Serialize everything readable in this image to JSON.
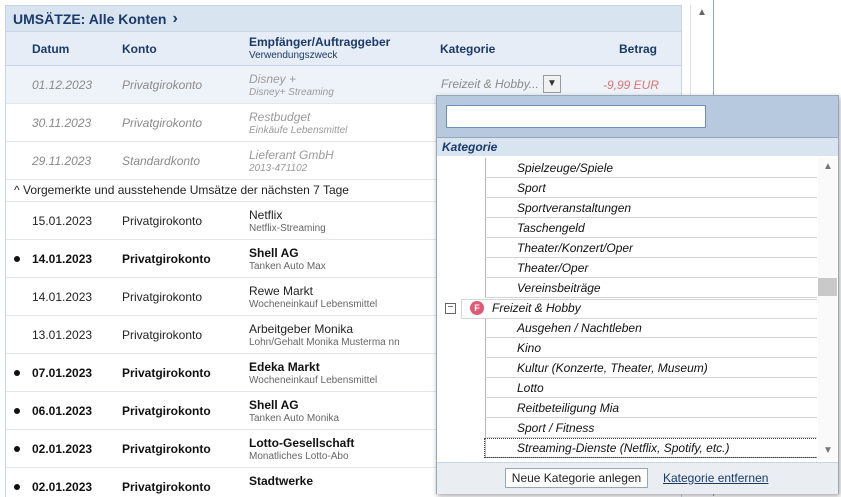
{
  "header": {
    "title": "UMSÄTZE: Alle Konten"
  },
  "columns": {
    "datum": "Datum",
    "konto": "Konto",
    "empfaenger": "Empfänger/Auftraggeber",
    "verwendung": "Verwendungszweck",
    "kategorie": "Kategorie",
    "betrag": "Betrag"
  },
  "past_rows": [
    {
      "date": "01.12.2023",
      "account": "Privatgirokonto",
      "payee": "Disney +",
      "purpose": "Disney+ Streaming",
      "category": "Freizeit & Hobby...",
      "amount": "-9,99 EUR"
    },
    {
      "date": "30.11.2023",
      "account": "Privatgirokonto",
      "payee": "Restbudget",
      "purpose": "Einkäufe Lebensmittel"
    },
    {
      "date": "29.11.2023",
      "account": "Standardkonto",
      "payee": "Lieferant GmbH",
      "purpose": "2013-471102"
    }
  ],
  "section": {
    "label": "Vorgemerkte und ausstehende Umsätze der nächsten 7 Tage"
  },
  "future_rows": [
    {
      "date": "15.01.2023",
      "account": "Privatgirokonto",
      "payee": "Netflix",
      "purpose": "Netflix-Streaming",
      "bold": false
    },
    {
      "date": "14.01.2023",
      "account": "Privatgirokonto",
      "payee": "Shell AG",
      "purpose": "Tanken Auto Max",
      "bold": true
    },
    {
      "date": "14.01.2023",
      "account": "Privatgirokonto",
      "payee": "Rewe Markt",
      "purpose": "Wocheneinkauf Lebensmittel",
      "bold": false
    },
    {
      "date": "13.01.2023",
      "account": "Privatgirokonto",
      "payee": "Arbeitgeber Monika",
      "purpose": "Lohn/Gehalt Monika Musterma nn",
      "bold": false
    },
    {
      "date": "07.01.2023",
      "account": "Privatgirokonto",
      "payee": "Edeka Markt",
      "purpose": "Wocheneinkauf Lebensmittel",
      "bold": true
    },
    {
      "date": "06.01.2023",
      "account": "Privatgirokonto",
      "payee": "Shell AG",
      "purpose": "Tanken Auto Monika",
      "bold": true
    },
    {
      "date": "02.01.2023",
      "account": "Privatgirokonto",
      "payee": "Lotto-Gesellschaft",
      "purpose": "Monatliches Lotto-Abo",
      "bold": true
    },
    {
      "date": "02.01.2023",
      "account": "Privatgirokonto",
      "payee": "Stadtwerke",
      "purpose": "",
      "bold": true
    }
  ],
  "popup": {
    "search_value": "",
    "header": "Kategorie",
    "items_before": [
      "Spielzeuge/Spiele",
      "Sport",
      "Sportveranstaltungen",
      "Taschengeld",
      "Theater/Konzert/Oper",
      "Theater/Oper",
      "Vereinsbeiträge"
    ],
    "parent": {
      "label": "Freizeit & Hobby",
      "icon_letter": "F"
    },
    "children": [
      "Ausgehen / Nachtleben",
      "Kino",
      "Kultur (Konzerte, Theater, Museum)",
      "Lotto",
      "Reitbeteiligung Mia",
      "Sport / Fitness",
      "Streaming-Dienste (Netflix, Spotify, etc.)"
    ],
    "buttons": {
      "new": "Neue Kategorie anlegen",
      "remove": "Kategorie entfernen"
    }
  }
}
